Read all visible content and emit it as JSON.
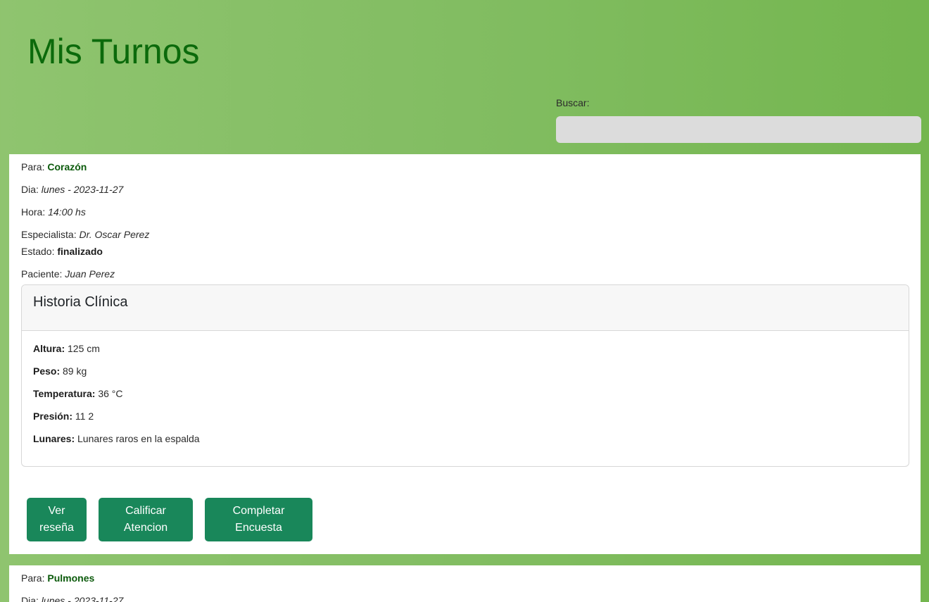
{
  "header": {
    "title": "Mis Turnos"
  },
  "search": {
    "label": "Buscar:",
    "value": "",
    "placeholder": ""
  },
  "turnos": [
    {
      "para_label": "Para:",
      "para_value": "Corazón",
      "dia_label": "Dia:",
      "dia_value": "lunes - 2023-11-27",
      "hora_label": "Hora:",
      "hora_value": "14:00 hs",
      "especialista_label": "Especialista:",
      "especialista_value": "Dr. Oscar Perez",
      "estado_label": "Estado:",
      "estado_value": "finalizado",
      "paciente_label": "Paciente:",
      "paciente_value": "Juan Perez",
      "historia": {
        "title": "Historia Clínica",
        "items": [
          {
            "label": "Altura:",
            "value": "125 cm"
          },
          {
            "label": "Peso:",
            "value": "89 kg"
          },
          {
            "label": "Temperatura:",
            "value": "36 °C"
          },
          {
            "label": "Presión:",
            "value": "11 2"
          },
          {
            "label": "Lunares:",
            "value": "Lunares raros en la espalda"
          }
        ]
      },
      "buttons": {
        "ver_resena": "Ver reseña",
        "calificar": "Calificar Atencion",
        "encuesta": "Completar Encuesta"
      }
    },
    {
      "para_label": "Para:",
      "para_value": "Pulmones",
      "dia_label": "Dia:",
      "dia_value": "lunes - 2023-11-27"
    }
  ],
  "colors": {
    "title_green": "#0b6a0b",
    "button_green": "#19875a",
    "background_green": "#82bd62"
  }
}
